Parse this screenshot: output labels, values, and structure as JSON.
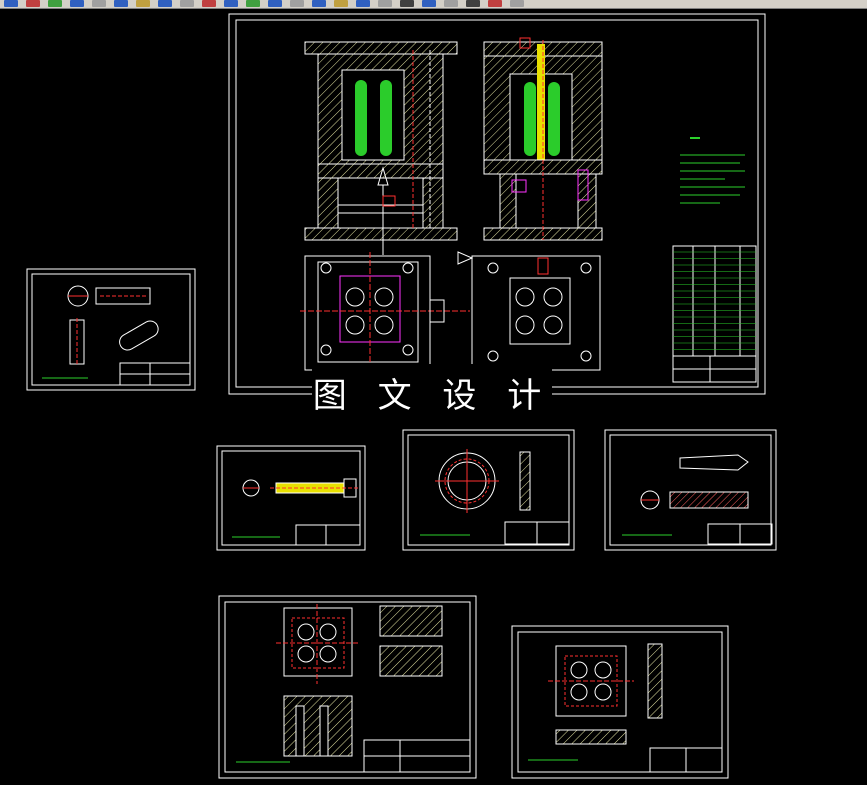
{
  "toolbar": {
    "button_count": 24
  },
  "watermark": {
    "text": "图 文 设 计"
  },
  "colors": {
    "background": "#000000",
    "line": "#ffffff",
    "core": "#33cc33",
    "accent_yellow": "#e8e000",
    "accent_red": "#ff3030",
    "accent_magenta": "#ff33ff",
    "accent_cyan": "#33cccc",
    "annotation": "#2bd12b"
  },
  "sheets": [
    {
      "id": "main-assembly"
    },
    {
      "id": "part-cylinder"
    },
    {
      "id": "part-rod"
    },
    {
      "id": "part-ring"
    },
    {
      "id": "part-core-pin"
    },
    {
      "id": "part-cavity-plate"
    },
    {
      "id": "part-core-plate"
    }
  ]
}
